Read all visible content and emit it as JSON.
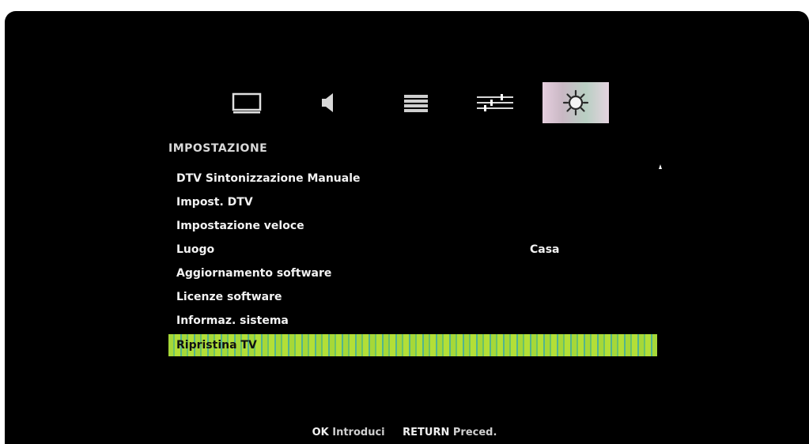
{
  "tabs": [
    {
      "name": "picture",
      "icon": "tv-picture-icon",
      "active": false
    },
    {
      "name": "sound",
      "icon": "speaker-icon",
      "active": false
    },
    {
      "name": "channels",
      "icon": "channel-list-icon",
      "active": false
    },
    {
      "name": "adjust",
      "icon": "sliders-icon",
      "active": false
    },
    {
      "name": "setup",
      "icon": "gear-icon",
      "active": true
    }
  ],
  "menu": {
    "title": "IMPOSTAZIONE",
    "items": [
      {
        "label": "DTV Sintonizzazione Manuale",
        "value": ""
      },
      {
        "label": "Impost. DTV",
        "value": ""
      },
      {
        "label": "Impostazione veloce",
        "value": ""
      },
      {
        "label": "Luogo",
        "value": "Casa"
      },
      {
        "label": "Aggiornamento software",
        "value": ""
      },
      {
        "label": "Licenze software",
        "value": ""
      },
      {
        "label": "Informaz. sistema",
        "value": ""
      },
      {
        "label": "Ripristina TV",
        "value": ""
      }
    ],
    "selected_index": 7
  },
  "footer": {
    "ok_key": "OK",
    "ok_label": "Introduci",
    "return_key": "RETURN",
    "return_label": "Preced."
  },
  "colors": {
    "background": "#000000",
    "text": "#f2f2f2",
    "highlight": "#a6d838",
    "active_tab": "#c9b8c4"
  }
}
